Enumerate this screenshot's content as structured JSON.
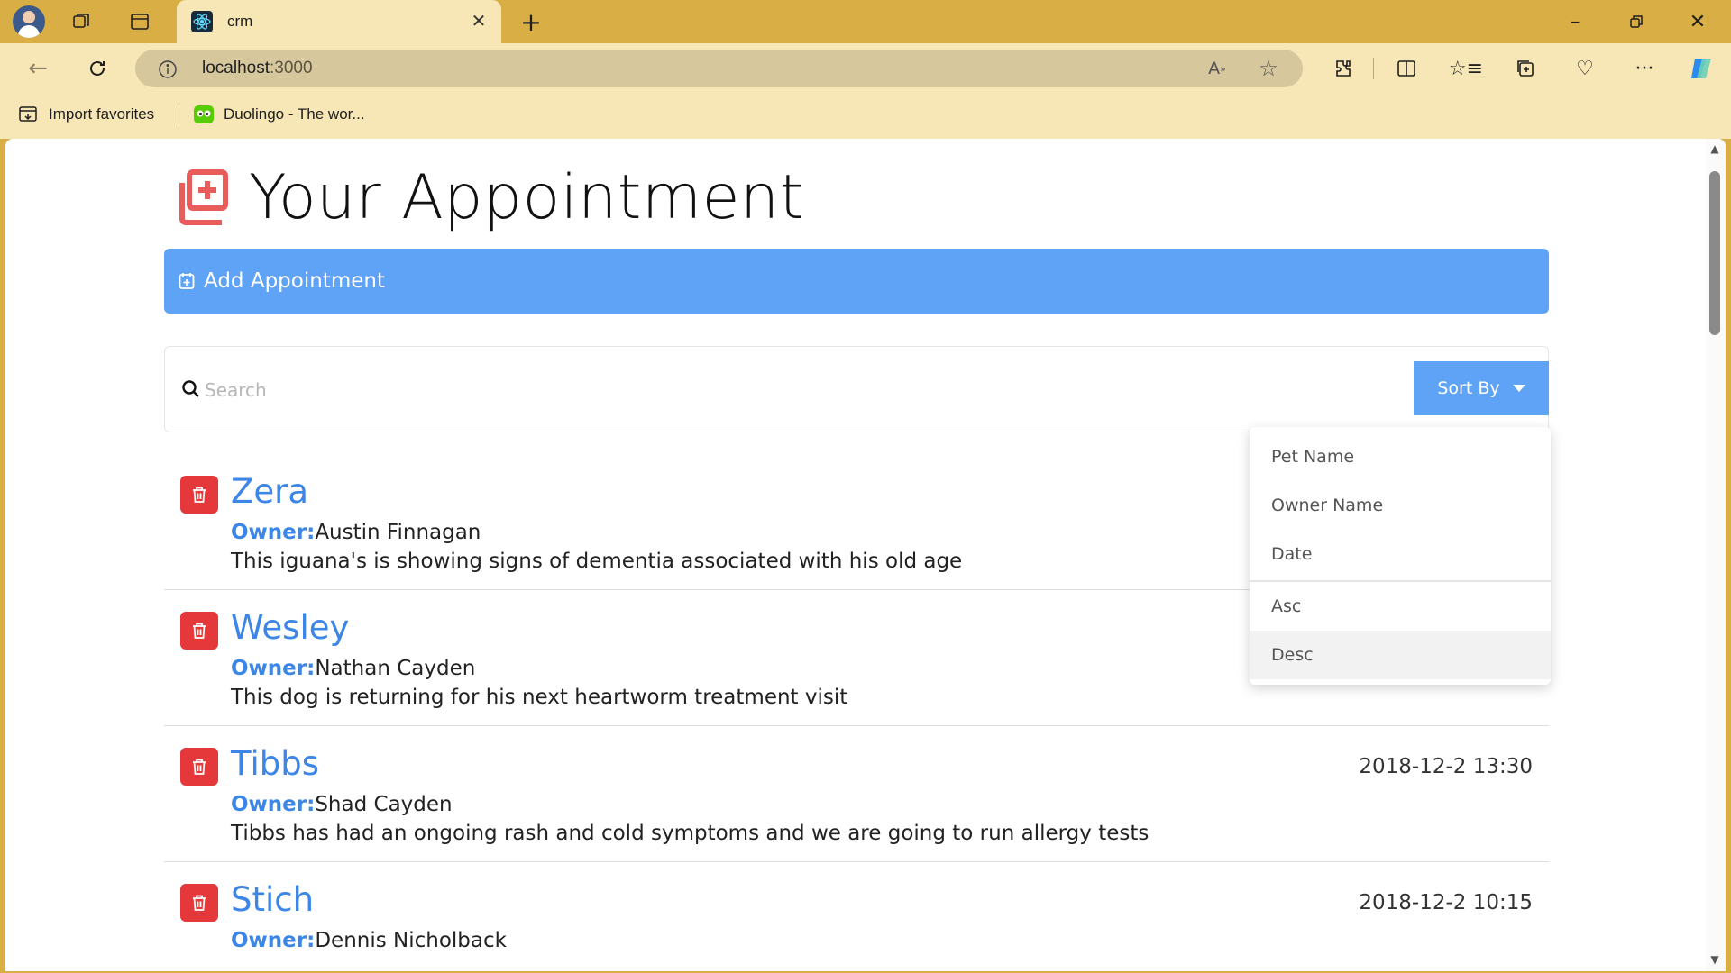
{
  "browser": {
    "tab_title": "crm",
    "url_host": "localhost",
    "url_port": ":3000",
    "favorites": [
      {
        "label": "Import favorites",
        "icon": "import-favorites-icon"
      },
      {
        "label": "Duolingo - The wor...",
        "icon": "duolingo-icon"
      }
    ]
  },
  "page": {
    "title": "Your Appointment",
    "add_button_label": "Add Appointment",
    "search_placeholder": "Search",
    "sort_button_label": "Sort By"
  },
  "sort_menu": {
    "fields": [
      "Pet Name",
      "Owner Name",
      "Date"
    ],
    "orders": [
      "Asc",
      "Desc"
    ],
    "highlighted": "Desc"
  },
  "appointments": [
    {
      "pet": "Zera",
      "owner_label": "Owner:",
      "owner": "Austin Finnagan",
      "notes": "This iguana's is showing signs of dementia associated with his old age",
      "date": ""
    },
    {
      "pet": "Wesley",
      "owner_label": "Owner:",
      "owner": "Nathan Cayden",
      "notes": "This dog is returning for his next heartworm treatment visit",
      "date": ""
    },
    {
      "pet": "Tibbs",
      "owner_label": "Owner:",
      "owner": "Shad Cayden",
      "notes": "Tibbs has had an ongoing rash and cold symptoms and we are going to run allergy tests",
      "date": "2018-12-2 13:30"
    },
    {
      "pet": "Stich",
      "owner_label": "Owner:",
      "owner": "Dennis Nicholback",
      "notes": "",
      "date": "2018-12-2 10:15"
    }
  ],
  "colors": {
    "accent_blue": "#5fa3f6",
    "link_blue": "#3c86e8",
    "delete_red": "#e5383b",
    "title_icon_red": "#e85c5c",
    "browser_frame": "#d9ae45"
  }
}
